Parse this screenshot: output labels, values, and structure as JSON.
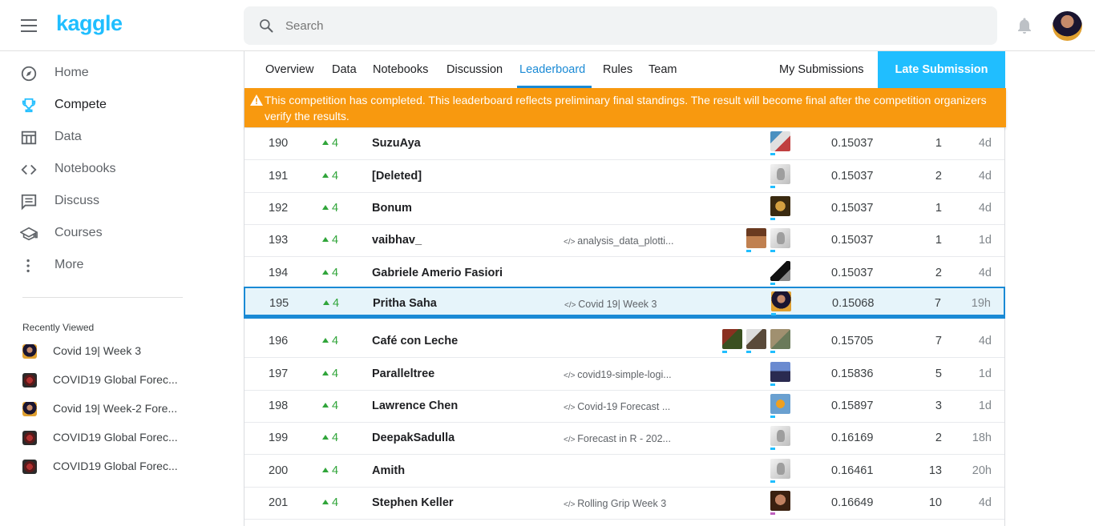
{
  "header": {
    "logo": "kaggle",
    "search_placeholder": "Search"
  },
  "sidebar": {
    "items": [
      {
        "label": "Home",
        "icon": "compass-icon"
      },
      {
        "label": "Compete",
        "icon": "trophy-icon"
      },
      {
        "label": "Data",
        "icon": "table-icon"
      },
      {
        "label": "Notebooks",
        "icon": "code-icon"
      },
      {
        "label": "Discuss",
        "icon": "comment-icon"
      },
      {
        "label": "Courses",
        "icon": "school-icon"
      },
      {
        "label": "More",
        "icon": "more-vert-icon"
      }
    ],
    "recently_viewed_title": "Recently Viewed",
    "recent": [
      {
        "label": "Covid 19| Week 3"
      },
      {
        "label": "COVID19 Global Forec..."
      },
      {
        "label": "Covid 19| Week-2 Fore..."
      },
      {
        "label": "COVID19 Global Forec..."
      },
      {
        "label": "COVID19 Global Forec..."
      }
    ]
  },
  "tabs": {
    "overview": "Overview",
    "data": "Data",
    "notebooks": "Notebooks",
    "discussion": "Discussion",
    "leaderboard": "Leaderboard",
    "rules": "Rules",
    "team": "Team",
    "my_submissions": "My Submissions",
    "late_submission": "Late Submission"
  },
  "banner": {
    "text": "This competition has completed. This leaderboard reflects preliminary final standings. The result will become final after the competition organizers verify the results."
  },
  "colors": {
    "brand": "#20beff",
    "active_tab": "#1a8ad5",
    "banner": "#f8990f",
    "rank_up": "#30a53a",
    "highlight_row": "#e6f4fa"
  },
  "leaderboard": {
    "rows": [
      {
        "rank": "190",
        "change": "4",
        "team": "SuzuAya",
        "kernel": "",
        "score": "0.15037",
        "entries": "1",
        "last": "4d"
      },
      {
        "rank": "191",
        "change": "4",
        "team": "[Deleted]",
        "kernel": "",
        "score": "0.15037",
        "entries": "2",
        "last": "4d"
      },
      {
        "rank": "192",
        "change": "4",
        "team": "Bonum",
        "kernel": "",
        "score": "0.15037",
        "entries": "1",
        "last": "4d"
      },
      {
        "rank": "193",
        "change": "4",
        "team": "vaibhav_",
        "kernel": "analysis_data_plotti...",
        "score": "0.15037",
        "entries": "1",
        "last": "1d"
      },
      {
        "rank": "194",
        "change": "4",
        "team": "Gabriele Amerio Fasiori",
        "kernel": "",
        "score": "0.15037",
        "entries": "2",
        "last": "4d"
      },
      {
        "rank": "195",
        "change": "4",
        "team": "Pritha Saha",
        "kernel": "Covid 19| Week 3",
        "score": "0.15068",
        "entries": "7",
        "last": "19h"
      },
      {
        "rank": "196",
        "change": "4",
        "team": "Café con Leche",
        "kernel": "",
        "score": "0.15705",
        "entries": "7",
        "last": "4d"
      },
      {
        "rank": "197",
        "change": "4",
        "team": "Paralleltree",
        "kernel": "covid19-simple-logi...",
        "score": "0.15836",
        "entries": "5",
        "last": "1d"
      },
      {
        "rank": "198",
        "change": "4",
        "team": "Lawrence Chen",
        "kernel": "Covid-19 Forecast ...",
        "score": "0.15897",
        "entries": "3",
        "last": "1d"
      },
      {
        "rank": "199",
        "change": "4",
        "team": "DeepakSadulla",
        "kernel": "Forecast in R - 202...",
        "score": "0.16169",
        "entries": "2",
        "last": "18h"
      },
      {
        "rank": "200",
        "change": "4",
        "team": "Amith",
        "kernel": "",
        "score": "0.16461",
        "entries": "13",
        "last": "20h"
      },
      {
        "rank": "201",
        "change": "4",
        "team": "Stephen Keller",
        "kernel": "Rolling Grip Week 3",
        "score": "0.16649",
        "entries": "10",
        "last": "4d"
      }
    ]
  }
}
